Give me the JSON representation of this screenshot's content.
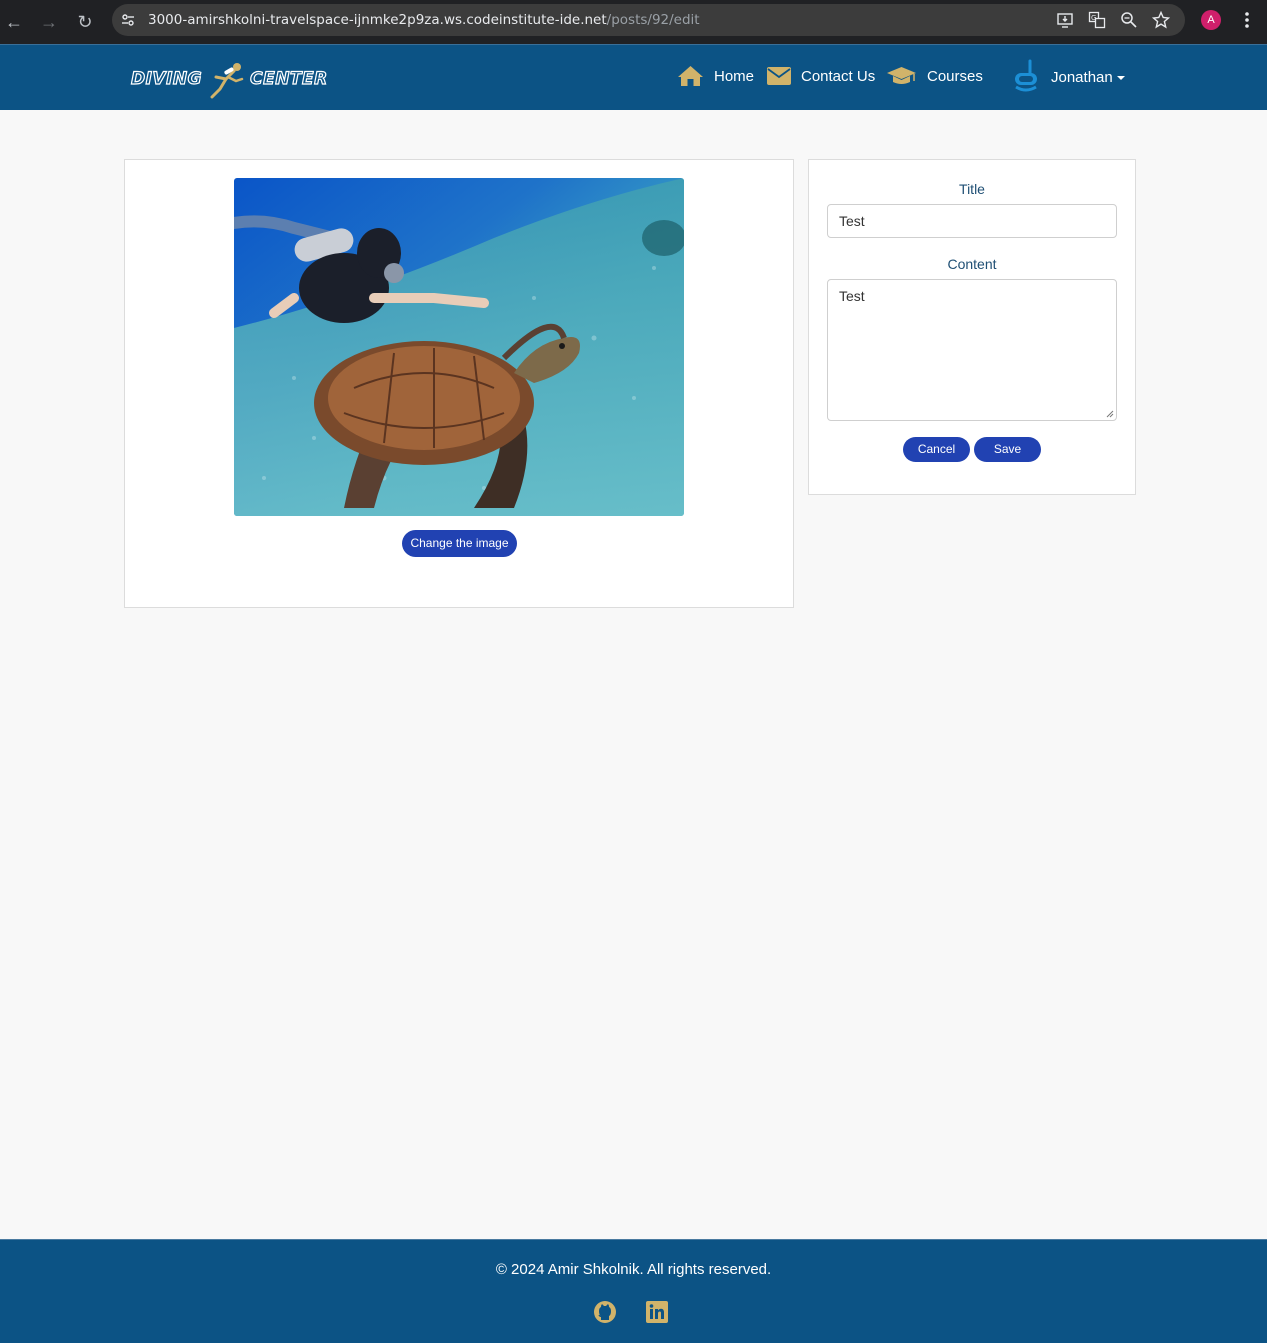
{
  "browser": {
    "url_host": "3000-amirshkolni-travelspace-ijnmke2p9za.ws.codeinstitute-ide.net",
    "url_path": "/posts/92/edit",
    "profile_initial": "A"
  },
  "navbar": {
    "logo_left": "DIVING",
    "logo_right": "CENTER",
    "items": [
      {
        "label": "Home",
        "icon": "home-icon"
      },
      {
        "label": "Contact Us",
        "icon": "envelope-icon"
      },
      {
        "label": "Courses",
        "icon": "graduation-cap-icon"
      }
    ],
    "user": {
      "name": "Jonathan",
      "icon": "snorkel-mask-icon"
    }
  },
  "image_card": {
    "change_label": "Change the image",
    "image_alt": "scuba diver photographing a sea turtle"
  },
  "form": {
    "title_label": "Title",
    "title_value": "Test",
    "content_label": "Content",
    "content_value": "Test",
    "cancel_label": "Cancel",
    "save_label": "Save"
  },
  "footer": {
    "copyright": "© 2024 Amir Shkolnik. All rights reserved.",
    "links": [
      "github-icon",
      "linkedin-icon"
    ]
  },
  "colors": {
    "navbar": "#0c5385",
    "accent_gold": "#d1b36a",
    "button_blue": "#2142b2",
    "page_bg": "#f8f8f8"
  }
}
